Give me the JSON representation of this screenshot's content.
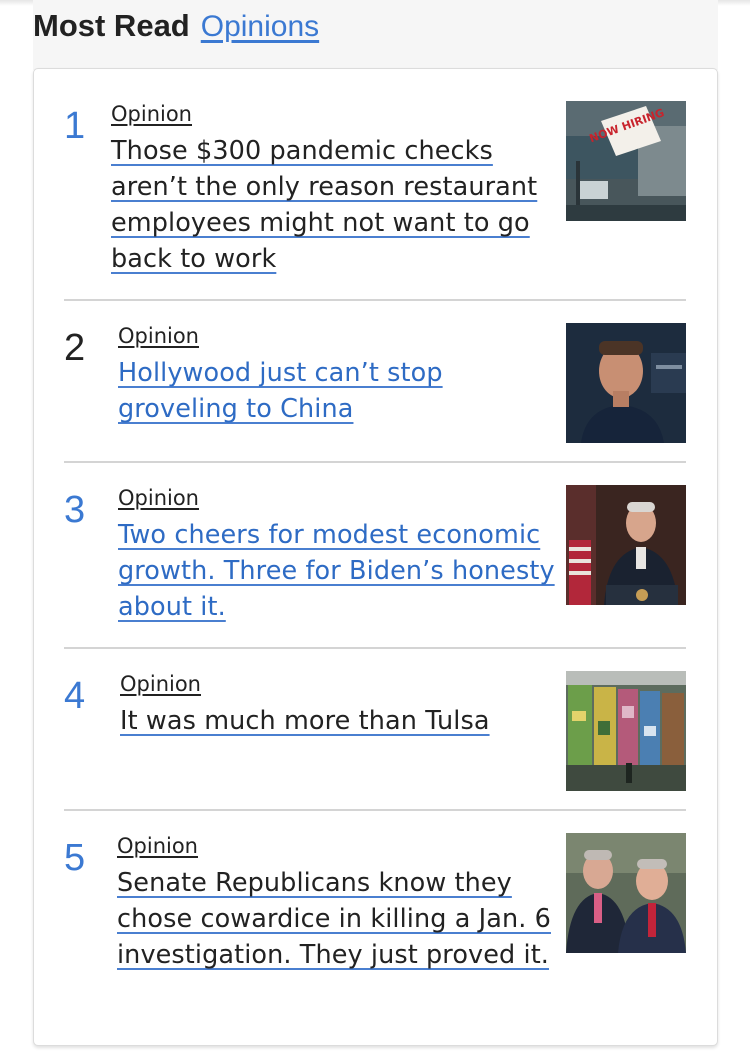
{
  "module": {
    "title": "Most Read",
    "section_link": "Opinions"
  },
  "articles": [
    {
      "rank": "1",
      "kicker": "Opinion",
      "headline": "Those $300 pandemic checks aren’t the only reason restaurant employees might not want to go back to work",
      "image_sign_text": "NOW HIRING"
    },
    {
      "rank": "2",
      "kicker": "Opinion",
      "headline": "Hollywood just can’t stop groveling to China"
    },
    {
      "rank": "3",
      "kicker": "Opinion",
      "headline": "Two cheers for modest economic growth. Three for Biden’s honesty about it."
    },
    {
      "rank": "4",
      "kicker": "Opinion",
      "headline": "It was much more than Tulsa"
    },
    {
      "rank": "5",
      "kicker": "Opinion",
      "headline": "Senate Republicans know they chose cowardice in killing a Jan. 6 investigation. They just proved it."
    }
  ],
  "colors": {
    "accent_blue": "#3b79d2",
    "text_dark": "#222222",
    "divider": "#d4d4d4"
  }
}
